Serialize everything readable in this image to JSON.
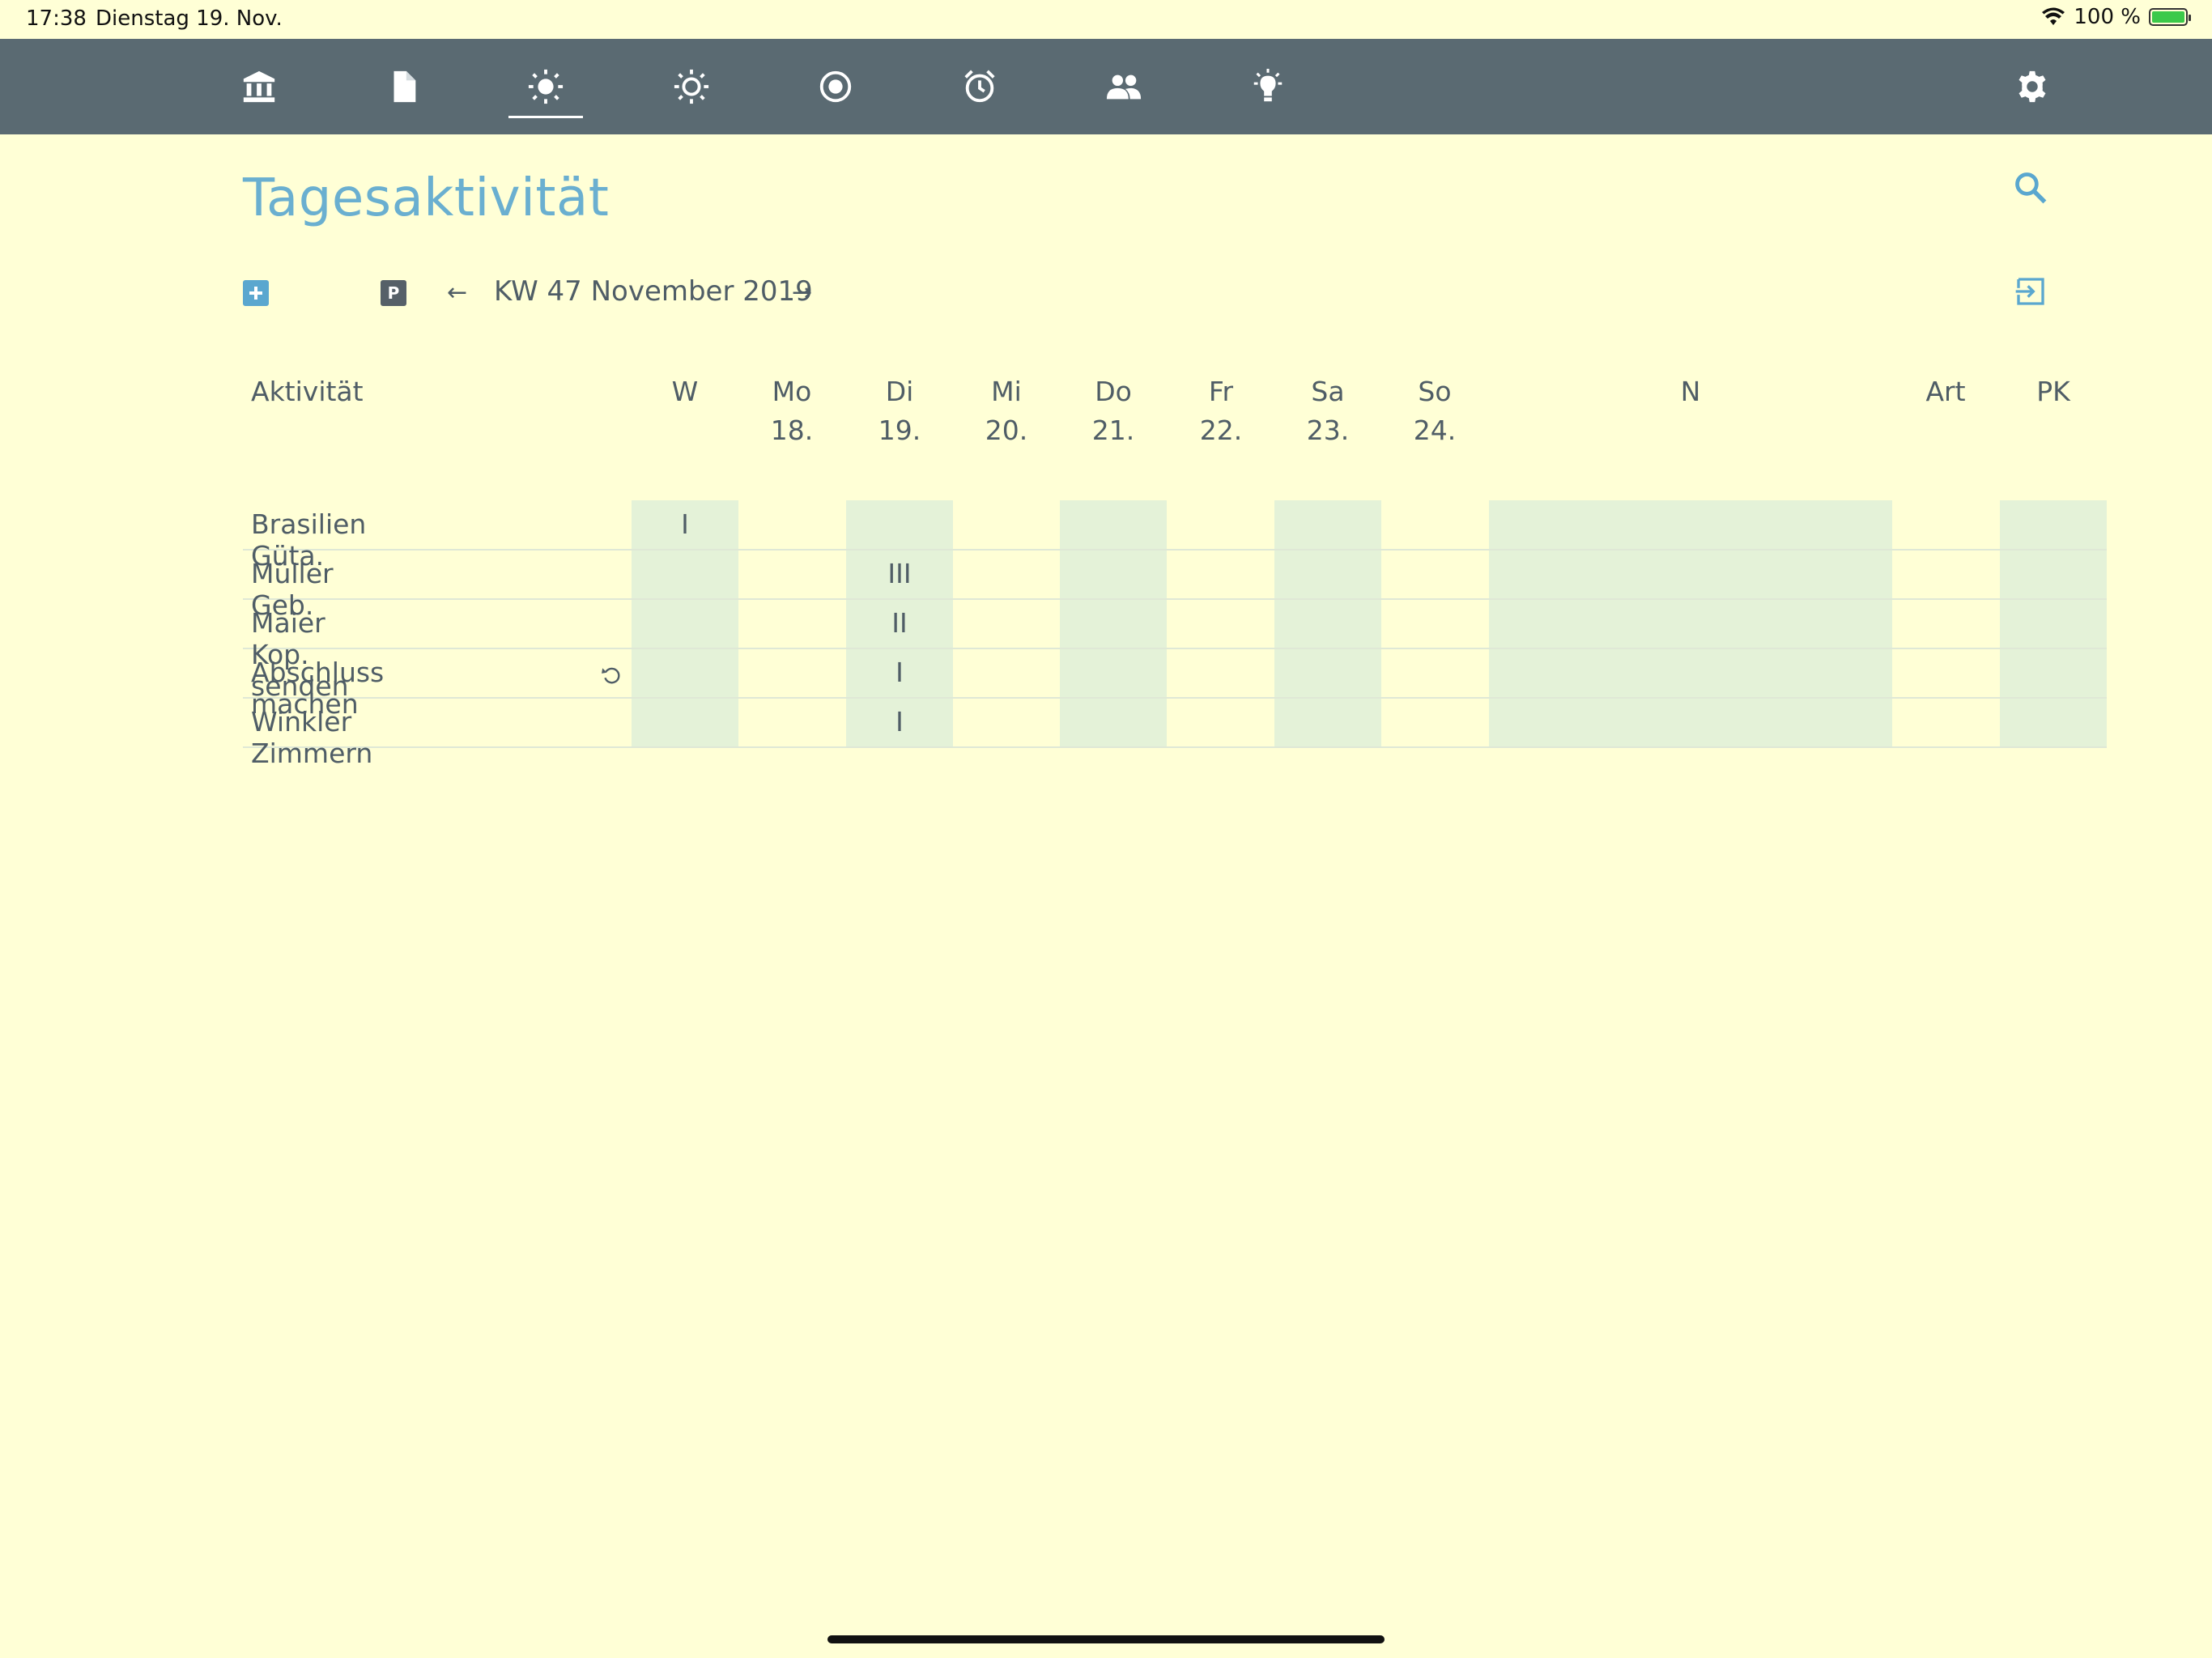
{
  "status_bar": {
    "time": "17:38",
    "date": "Dienstag 19. Nov.",
    "battery": "100 %"
  },
  "toolbar": {
    "icons": [
      "bank-icon",
      "document-icon",
      "sun-icon",
      "sun-outline-icon",
      "target-icon",
      "alarm-icon",
      "people-icon",
      "lightbulb-icon",
      "gear-icon"
    ],
    "active": "sun-icon"
  },
  "page": {
    "title": "Tagesaktivität"
  },
  "week_nav": {
    "p_label": "P",
    "prev": "←",
    "next": "→",
    "label": "KW 47 November 2019"
  },
  "table": {
    "header_activity": "Aktivität",
    "columns": [
      {
        "key": "W",
        "day": "W",
        "date": ""
      },
      {
        "key": "Mo",
        "day": "Mo",
        "date": "18."
      },
      {
        "key": "Di",
        "day": "Di",
        "date": "19."
      },
      {
        "key": "Mi",
        "day": "Mi",
        "date": "20."
      },
      {
        "key": "Do",
        "day": "Do",
        "date": "21."
      },
      {
        "key": "Fr",
        "day": "Fr",
        "date": "22."
      },
      {
        "key": "Sa",
        "day": "Sa",
        "date": "23."
      },
      {
        "key": "So",
        "day": "So",
        "date": "24."
      },
      {
        "key": "N",
        "day": "N",
        "date": ""
      },
      {
        "key": "Art",
        "day": "Art",
        "date": ""
      },
      {
        "key": "PK",
        "day": "PK",
        "date": ""
      }
    ],
    "rows": [
      {
        "label": "Brasilien Güta.",
        "repeat": false,
        "cells": {
          "W": "I"
        }
      },
      {
        "label": "Müller Geb.",
        "repeat": false,
        "cells": {
          "Di": "III"
        }
      },
      {
        "label": "Maier Kop. senden",
        "repeat": false,
        "cells": {
          "Di": "II"
        }
      },
      {
        "label": "Abschluss machen",
        "repeat": true,
        "cells": {
          "Di": "I"
        }
      },
      {
        "label": "Winkler Zimmern",
        "repeat": false,
        "cells": {
          "Di": "I"
        }
      }
    ]
  },
  "colors": {
    "background": "#ffffd6",
    "toolbar": "#5a6a72",
    "title": "#6aafd0",
    "shade": "#e4f2d8",
    "text": "#4f5d66"
  }
}
